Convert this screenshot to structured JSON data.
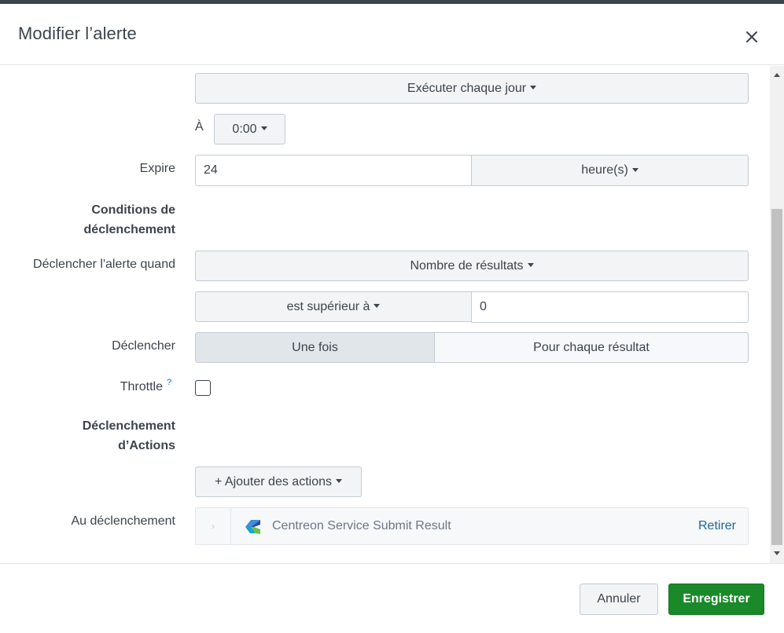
{
  "dialog": {
    "title": "Modifier l’alerte",
    "close_icon": "close-icon"
  },
  "schedule": {
    "run_label": "Exécuter chaque jour",
    "at_label": "À",
    "time_value": "0:00"
  },
  "expire": {
    "label": "Expire",
    "value": "24",
    "unit": "heure(s)"
  },
  "trigger_conditions": {
    "section_line1": "Conditions de",
    "section_line2": "déclenchement",
    "when_label": "Déclencher l'alerte quand",
    "when_value": "Nombre de résultats",
    "comparator": "est supérieur à",
    "threshold": "0"
  },
  "trigger": {
    "label": "Déclencher",
    "options": [
      "Une fois",
      "Pour chaque résultat"
    ],
    "selected": "Une fois"
  },
  "throttle": {
    "label": "Throttle",
    "help": "?",
    "checked": false
  },
  "actions": {
    "section_line1": "Déclenchement",
    "section_line2": "d’Actions",
    "add_button": "+ Ajouter des actions",
    "on_trigger_label": "Au déclenchement",
    "items": [
      {
        "name": "Centreon Service Submit Result",
        "remove_label": "Retirer",
        "icon": "centreon-logo-icon"
      }
    ]
  },
  "footer": {
    "cancel_label": "Annuler",
    "save_label": "Enregistrer"
  },
  "colors": {
    "primary_green": "#1a8929",
    "link_blue": "#1a6696",
    "text": "#3c444d",
    "border": "#c3cbd4"
  }
}
